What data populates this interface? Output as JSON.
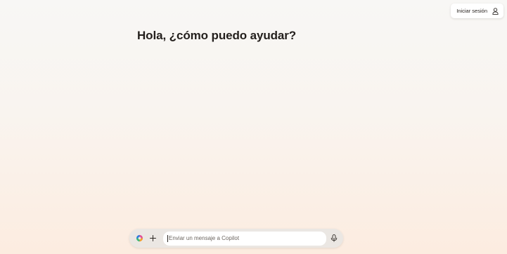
{
  "header": {
    "signin_label": "Iniciar sesión",
    "signin_icon": "user-icon"
  },
  "main": {
    "greeting": "Hola, ¿cómo puedo ayudar?"
  },
  "composer": {
    "placeholder": "Enviar un mensaje a Copilot",
    "value": "",
    "logo_icon": "copilot-logo-icon",
    "add_icon": "plus-icon",
    "mic_icon": "microphone-icon"
  },
  "colors": {
    "background_top": "#f8f7f5",
    "background_bottom": "#fcece0",
    "text": "#231f1c",
    "composer_bg": "#ebe7e3"
  }
}
